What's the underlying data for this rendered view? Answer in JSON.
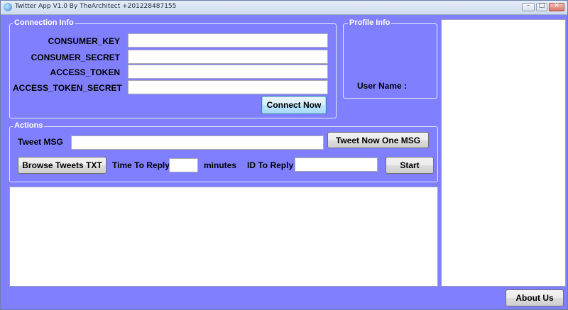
{
  "window": {
    "title": "Twitter App V1.0 By TheArchitect +201228487155",
    "minimize_glyph": "–",
    "maximize_glyph": "□",
    "close_glyph": "✕"
  },
  "connection": {
    "legend": "Connection Info",
    "consumer_key_label": "CONSUMER_KEY",
    "consumer_key_value": "",
    "consumer_secret_label": "CONSUMER_SECRET",
    "consumer_secret_value": "",
    "access_token_label": "ACCESS_TOKEN",
    "access_token_value": "",
    "access_token_secret_label": "ACCESS_TOKEN_SECRET",
    "access_token_secret_value": "",
    "connect_button": "Connect Now"
  },
  "profile": {
    "legend": "Profile Info",
    "user_name_label": "User Name :"
  },
  "actions": {
    "legend": "Actions",
    "tweet_msg_label": "Tweet MSG",
    "tweet_msg_value": "",
    "tweet_now_button": "Tweet Now One MSG",
    "browse_button": "Browse Tweets TXT",
    "time_to_reply_label": "Time To Reply",
    "time_to_reply_value": "",
    "minutes_label": "minutes",
    "id_to_reply_label": "ID To Reply",
    "id_to_reply_value": "",
    "start_button": "Start"
  },
  "footer": {
    "about_button": "About Us"
  },
  "colors": {
    "background": "#8080ff",
    "border": "#e6e6ff"
  }
}
